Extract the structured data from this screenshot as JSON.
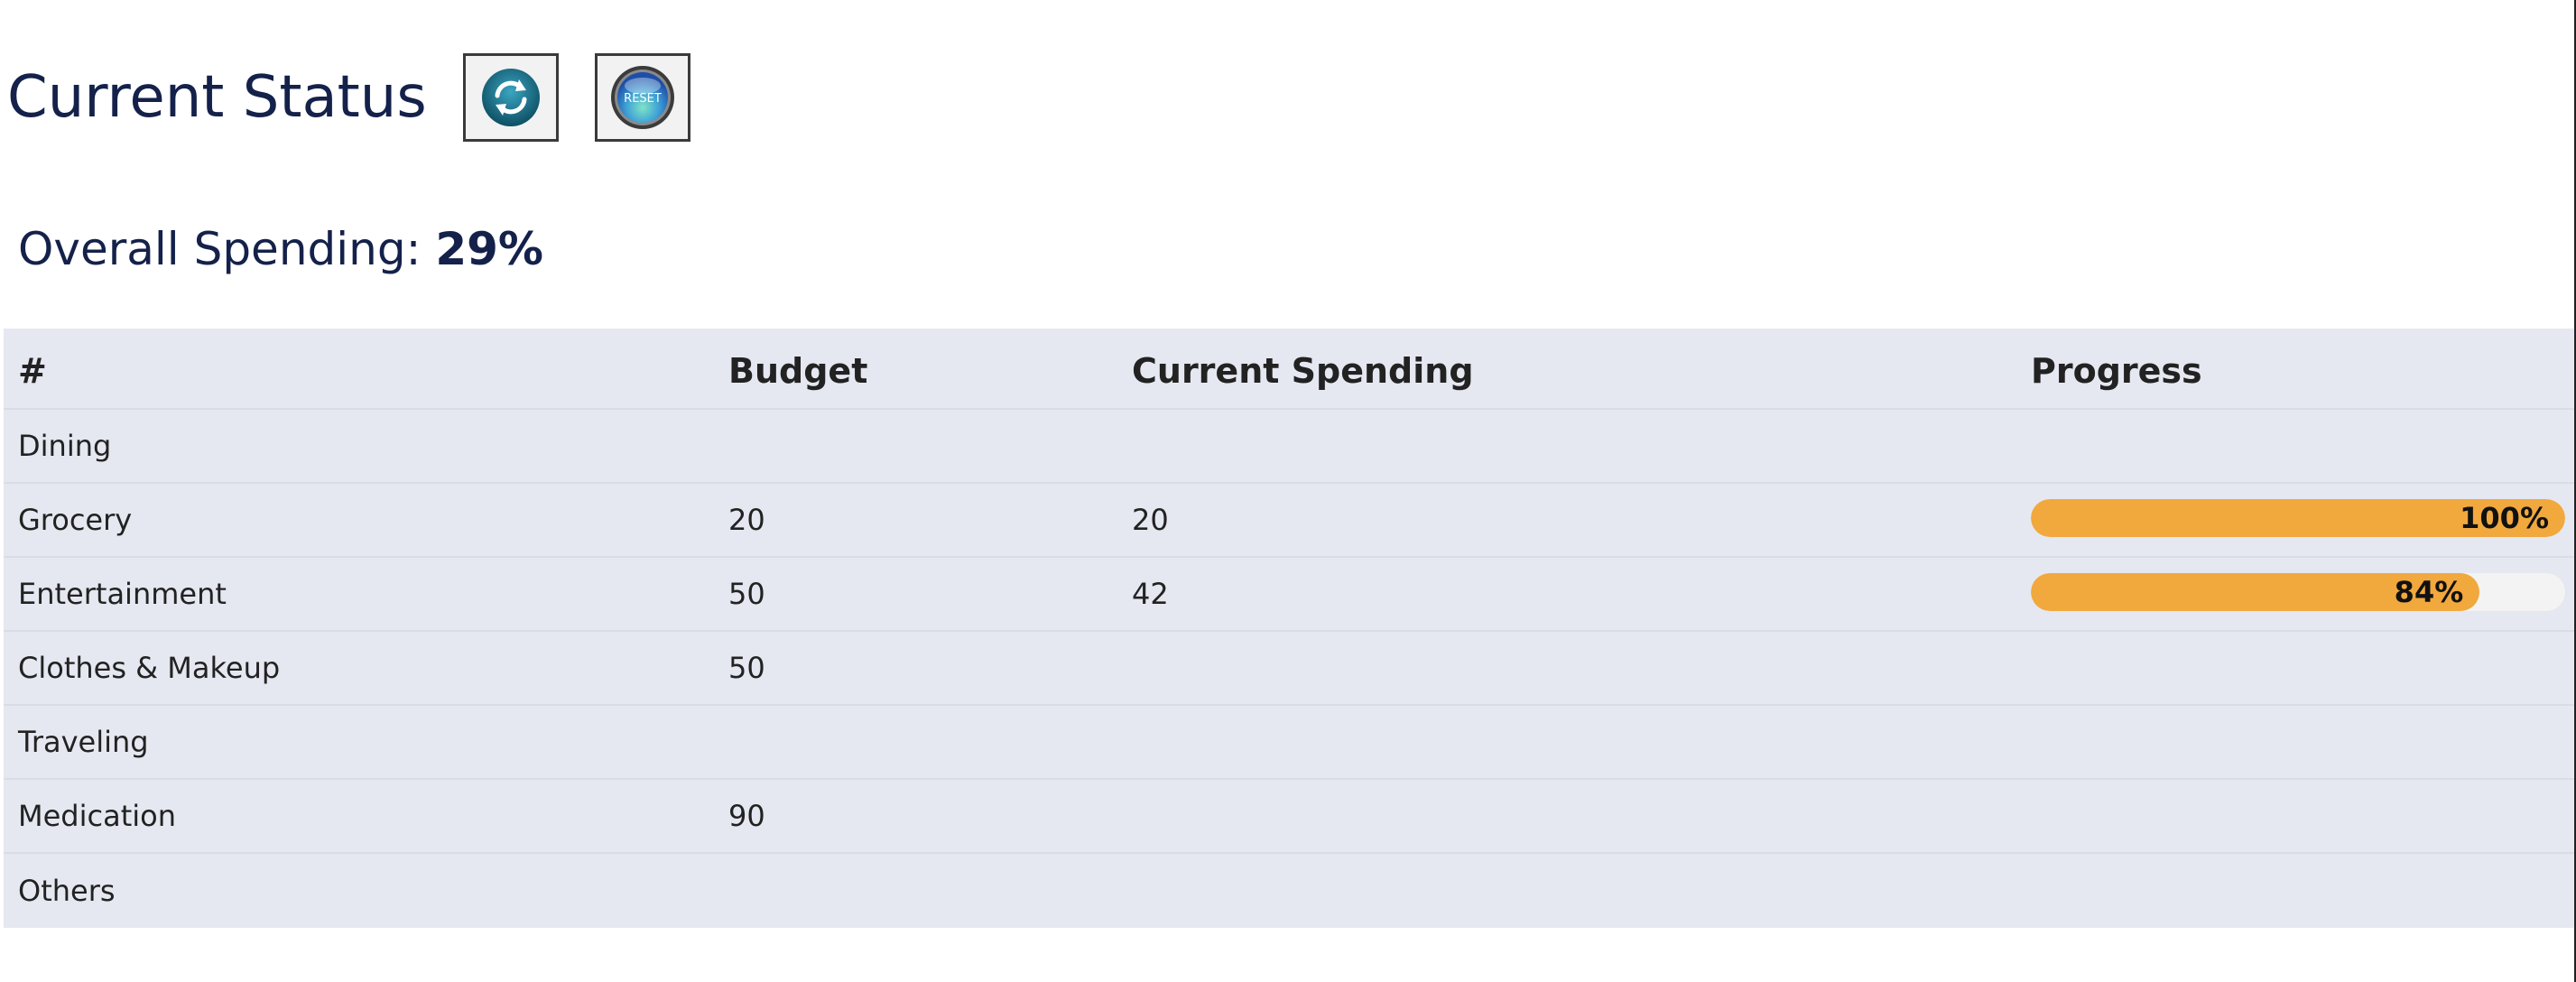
{
  "header": {
    "title": "Current Status"
  },
  "buttons": {
    "refresh_icon": "refresh-icon",
    "reset_label": "RESET"
  },
  "overall": {
    "label": "Overall Spending:",
    "value": "29%"
  },
  "table": {
    "columns": [
      "#",
      "Budget",
      "Current Spending",
      "Progress"
    ],
    "rows": [
      {
        "category": "Dining",
        "budget": "",
        "spending": "",
        "progress": null,
        "progress_label": ""
      },
      {
        "category": "Grocery",
        "budget": "20",
        "spending": "20",
        "progress": 100,
        "progress_label": "100%"
      },
      {
        "category": "Entertainment",
        "budget": "50",
        "spending": "42",
        "progress": 84,
        "progress_label": "84%"
      },
      {
        "category": "Clothes & Makeup",
        "budget": "50",
        "spending": "",
        "progress": null,
        "progress_label": ""
      },
      {
        "category": "Traveling",
        "budget": "",
        "spending": "",
        "progress": null,
        "progress_label": ""
      },
      {
        "category": "Medication",
        "budget": "90",
        "spending": "",
        "progress": null,
        "progress_label": ""
      },
      {
        "category": "Others",
        "budget": "",
        "spending": "",
        "progress": null,
        "progress_label": ""
      }
    ]
  },
  "colors": {
    "title_text": "#14214a",
    "table_bg": "#e5e8f1",
    "progress_fill": "#f1a83d",
    "progress_track": "#f3f3f3"
  }
}
